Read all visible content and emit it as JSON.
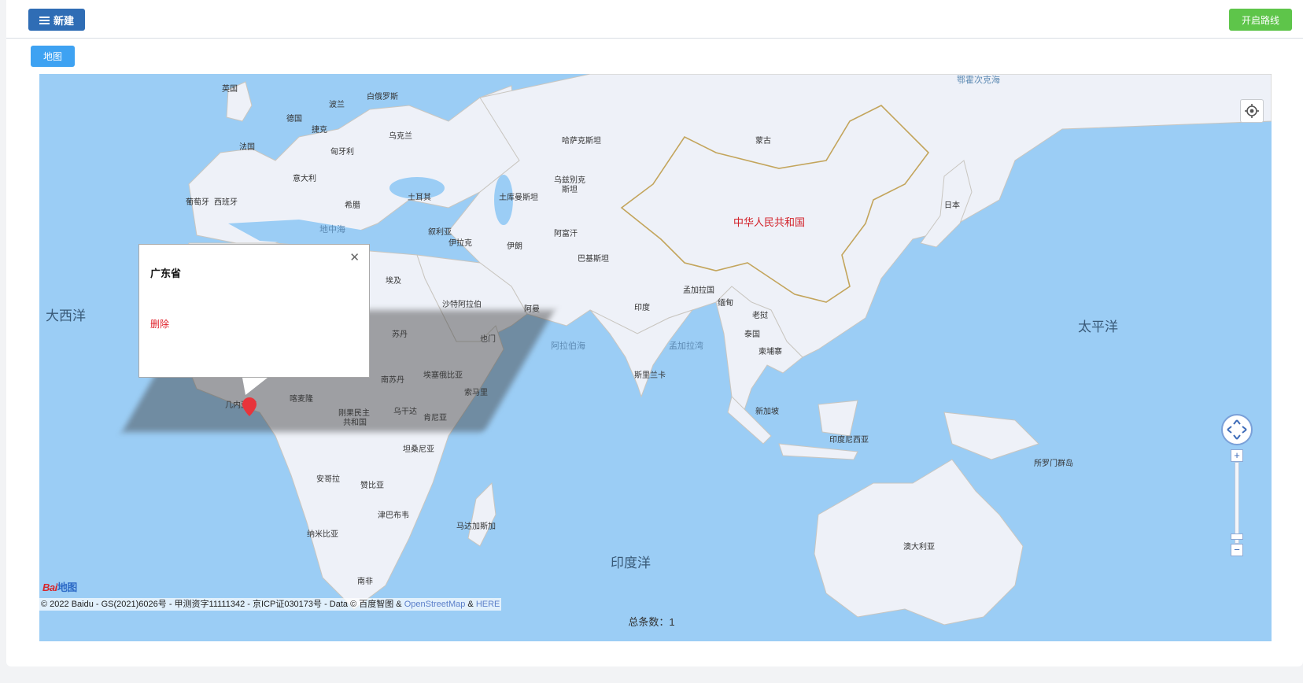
{
  "toolbar": {
    "new_button_label": "新建",
    "route_button_label": "开启路线"
  },
  "tabs": {
    "map_label": "地图"
  },
  "map": {
    "labels": {
      "uk": "英国",
      "poland": "波兰",
      "belarus": "白俄罗斯",
      "germany": "德国",
      "czech": "捷克",
      "ukraine": "乌克兰",
      "france": "法国",
      "hungary": "匈牙利",
      "italy": "意大利",
      "portugal": "葡萄牙",
      "spain": "西班牙",
      "greece": "希腊",
      "turkey": "土耳其",
      "mediterranean": "地中海",
      "syria": "叙利亚",
      "iraq": "伊拉克",
      "iran": "伊朗",
      "egypt": "埃及",
      "saudi": "沙特阿拉伯",
      "oman": "阿曼",
      "yemen": "也门",
      "sudan": "苏丹",
      "south_sudan": "南苏丹",
      "ethiopia": "埃塞俄比亚",
      "somalia": "索马里",
      "cameroon": "喀麦隆",
      "congo_drc_1": "刚果民主",
      "congo_drc_2": "共和国",
      "uganda": "乌干达",
      "kenya": "肯尼亚",
      "tanzania": "坦桑尼亚",
      "angola": "安哥拉",
      "zambia": "赞比亚",
      "zimbabwe": "津巴布韦",
      "namibia": "纳米比亚",
      "madagascar": "马达加斯加",
      "south_africa": "南非",
      "gulf_guinea": "几内亚湾",
      "kazakhstan": "哈萨克斯坦",
      "uzbekistan_1": "乌兹别克",
      "uzbekistan_2": "斯坦",
      "turkmenistan": "土库曼斯坦",
      "afghanistan": "阿富汗",
      "pakistan": "巴基斯坦",
      "india": "印度",
      "bangladesh": "孟加拉国",
      "myanmar": "缅甸",
      "laos": "老挝",
      "thailand": "泰国",
      "cambodia": "柬埔寨",
      "sri_lanka": "斯里兰卡",
      "singapore": "新加坡",
      "indonesia": "印度尼西亚",
      "mongolia": "蒙古",
      "china": "中华人民共和国",
      "japan": "日本",
      "okhotsk": "鄂霍次克海",
      "arabian_sea": "阿拉伯海",
      "bay_bengal": "孟加拉湾",
      "atlantic": "大西洋",
      "pacific": "太平洋",
      "indian_ocean": "印度洋",
      "australia": "澳大利亚",
      "solomon": "所罗门群岛"
    },
    "logo_text": "Bai",
    "logo_suffix": "地图",
    "copyright_text": "© 2022 Baidu - GS(2021)6026号 - 甲测资字11111342 - 京ICP证030173号 - Data © 百度智图 & ",
    "copyright_link1": "OpenStreetMap",
    "copyright_amp": " & ",
    "copyright_link2": "HERE",
    "controls": {
      "locate_icon": "locate-icon",
      "zoom_in_label": "+",
      "zoom_out_label": "−"
    }
  },
  "popup": {
    "title": "广东省",
    "close_label": "✕",
    "delete_label": "删除"
  },
  "footer": {
    "total_label": "总条数：1"
  },
  "colors": {
    "primary": "#2f6db5",
    "success": "#5ec54a",
    "tab": "#3ea2f2",
    "water": "#9bcdf5",
    "land": "#eef1f8",
    "danger": "#e0202a"
  }
}
